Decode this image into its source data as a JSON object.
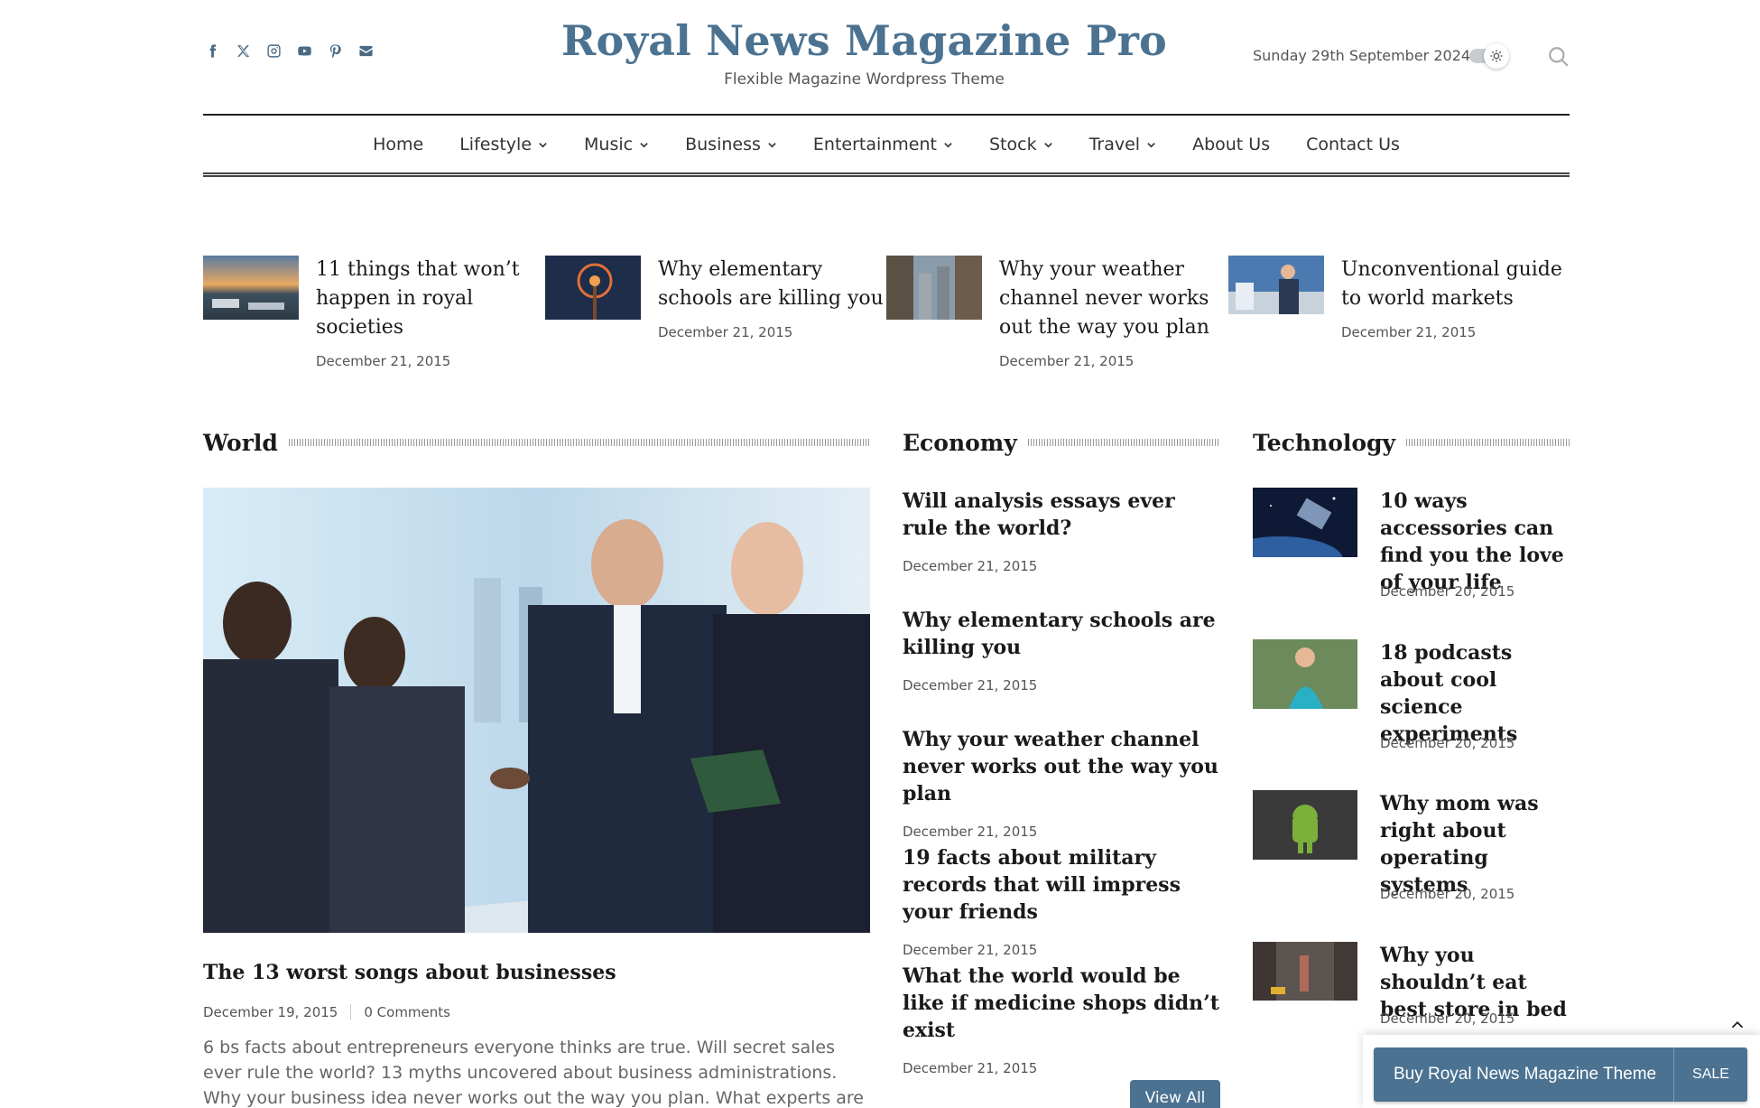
{
  "header": {
    "site_title": "Royal News Magazine Pro",
    "tagline": "Flexible Magazine Wordpress Theme",
    "date": "Sunday 29th September 2024",
    "social_icons": [
      "facebook-icon",
      "x-icon",
      "instagram-icon",
      "youtube-icon",
      "pinterest-icon",
      "email-icon"
    ]
  },
  "nav": {
    "items": [
      {
        "label": "Home",
        "dropdown": false
      },
      {
        "label": "Lifestyle",
        "dropdown": true
      },
      {
        "label": "Music",
        "dropdown": true
      },
      {
        "label": "Business",
        "dropdown": true
      },
      {
        "label": "Entertainment",
        "dropdown": true
      },
      {
        "label": "Stock",
        "dropdown": true
      },
      {
        "label": "Travel",
        "dropdown": true
      },
      {
        "label": "About Us",
        "dropdown": false
      },
      {
        "label": "Contact Us",
        "dropdown": false
      }
    ]
  },
  "featured": [
    {
      "title": "11 things that won’t happen in royal societies",
      "date": "December 21, 2015"
    },
    {
      "title": "Why elementary schools are killing you",
      "date": "December 21, 2015"
    },
    {
      "title": "Why your weather channel never works out the way you plan",
      "date": "December 21, 2015"
    },
    {
      "title": "Unconventional guide to world markets",
      "date": "December 21, 2015"
    }
  ],
  "world": {
    "heading": "World",
    "title": "The 13 worst songs about businesses",
    "date": "December 19, 2015",
    "comments": "0 Comments",
    "excerpt": "6 bs facts about entrepreneurs everyone thinks are true. Will secret sales ever rule the world? 13 myths uncovered about business administrations. Why your business idea never works out the way you plan. What experts are saying about"
  },
  "economy": {
    "heading": "Economy",
    "items": [
      {
        "title": "Will analysis essays ever rule the world?",
        "date": "December 21, 2015"
      },
      {
        "title": "Why elementary schools are killing you",
        "date": "December 21, 2015"
      },
      {
        "title": "Why your weather channel never works out the way you plan",
        "date": "December 21, 2015"
      },
      {
        "title": "19 facts about military records that will impress your friends",
        "date": "December 21, 2015"
      },
      {
        "title": "What the world would be like if medicine shops didn’t exist",
        "date": "December 21, 2015"
      }
    ],
    "view_all": "View All"
  },
  "technology": {
    "heading": "Technology",
    "items": [
      {
        "title": "10 ways accessories can find you the love of your life",
        "date": "December 20, 2015"
      },
      {
        "title": "18 podcasts about cool science experiments",
        "date": "December 20, 2015"
      },
      {
        "title": "Why mom was right about operating systems",
        "date": "December 20, 2015"
      },
      {
        "title": "Why you shouldn’t eat best store in bed",
        "date": "December 20, 2015"
      }
    ]
  },
  "buy_bar": {
    "label": "Buy Royal News Magazine Theme",
    "badge": "SALE"
  },
  "colors": {
    "brand": "#4b7291",
    "text": "#1a1a1a"
  }
}
